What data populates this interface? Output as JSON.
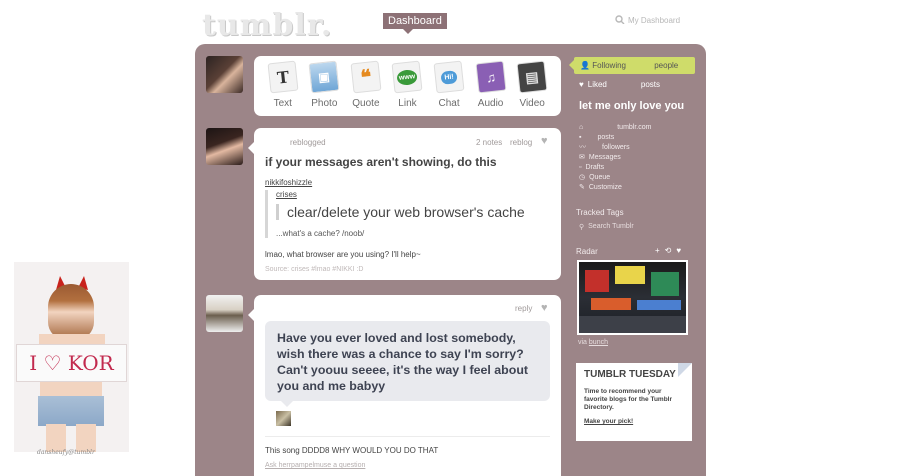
{
  "header": {
    "logo": "tumblr.",
    "dashboard_tab": "Dashboard",
    "search_label": "My Dashboard"
  },
  "post_types": [
    {
      "label": "Text",
      "glyph": "T",
      "icon": "text-icon"
    },
    {
      "label": "Photo",
      "glyph": "▣",
      "icon": "photo-icon"
    },
    {
      "label": "Quote",
      "glyph": "❝",
      "icon": "quote-icon"
    },
    {
      "label": "Link",
      "glyph": "www",
      "icon": "link-icon"
    },
    {
      "label": "Chat",
      "glyph": "Hi!",
      "icon": "chat-icon"
    },
    {
      "label": "Audio",
      "glyph": "♫",
      "icon": "audio-icon"
    },
    {
      "label": "Video",
      "glyph": "▤",
      "icon": "video-icon"
    }
  ],
  "post1": {
    "reblogged": "reblogged",
    "notes": "2 notes",
    "reblog": "reblog",
    "title": "if your messages aren't showing, do this",
    "user1": "nikkifoshizzle",
    "user2": "crises",
    "quote_big": "clear/delete your web browser's cache",
    "quote_small": "...what's a cache? /noob/",
    "answer": "lmao, what browser are you using? I'll help~",
    "source": "Source: crises   #lmao   #NIKKI :D"
  },
  "post2": {
    "reply": "reply",
    "bubble": "Have you ever loved and lost somebody, wish there was a chance to say I'm sorry? Can't yoouu seeee, it's the way I feel about you and me babyy",
    "caption": "This song DDDD8 WHY WOULD YOU DO THAT",
    "ask": "Ask herrpampelmuse a question"
  },
  "sidebar": {
    "following": "Following",
    "people": "people",
    "liked": "Liked",
    "posts": "posts",
    "blog_title": "let me only love you",
    "items": [
      {
        "label": "tumblr.com",
        "icon": "home-icon"
      },
      {
        "label": "posts",
        "icon": "doc-icon"
      },
      {
        "label": "followers",
        "icon": "activity-icon"
      },
      {
        "label": "Messages",
        "icon": "mail-icon"
      },
      {
        "label": "Drafts",
        "icon": "draft-icon"
      },
      {
        "label": "Queue",
        "icon": "clock-icon"
      },
      {
        "label": "Customize",
        "icon": "wrench-icon"
      }
    ],
    "tracked_tags": "Tracked Tags",
    "search_tumblr": "Search Tumblr",
    "radar": "Radar",
    "via": "via",
    "via_user": "bunch",
    "tt_title": "TUMBLR TUESDAY",
    "tt_text": "Time to recommend your favorite blogs for the Tumblr Directory.",
    "tt_link": "Make your pick!"
  },
  "fan_image": {
    "sign_text": "I ♡ KOR",
    "caption": "dansheufy@tumblr"
  },
  "colors": {
    "panel": "#9c8588",
    "following_highlight": "#cfdc6a",
    "tab": "#8d7176"
  }
}
